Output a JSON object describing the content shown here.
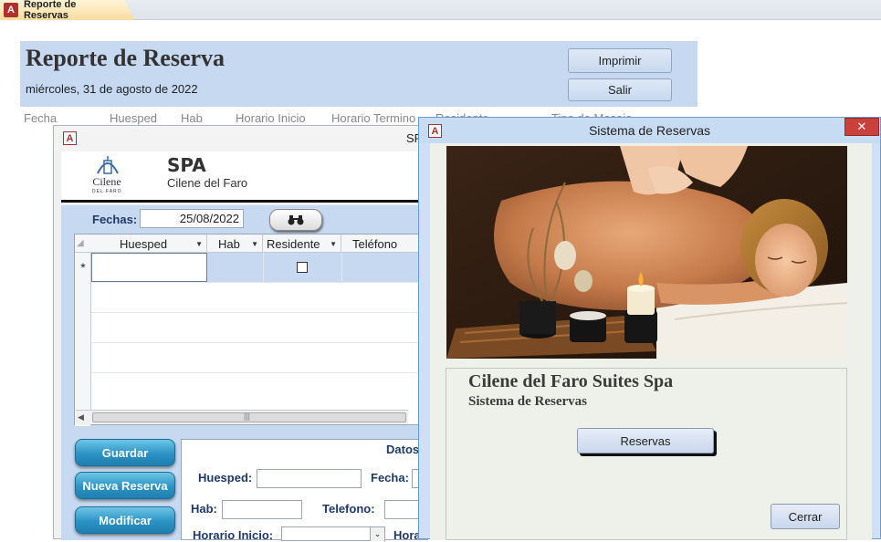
{
  "tab": {
    "label": "Reporte de Reservas",
    "icon": "access-app-icon"
  },
  "report": {
    "title": "Reporte de Reserva",
    "date": "miércoles, 31 de agosto de 2022",
    "print_label": "Imprimir",
    "exit_label": "Salir",
    "columns": [
      "Fecha",
      "Huesped",
      "Hab",
      "Horario Inicio",
      "Horario Termino",
      "Residente",
      "Tipo de Masaje"
    ]
  },
  "spa_form": {
    "window_title": "SPA",
    "title": "SPA",
    "subtitle": "Cilene del Faro",
    "logo_text": "Cilene",
    "logo_small": "DEL FARO",
    "fechas_label": "Fechas:",
    "fechas_value": "25/08/2022",
    "grid_headers": [
      "Huesped",
      "Hab",
      "Residente",
      "Teléfono"
    ],
    "new_row_marker": "*",
    "buttons": {
      "guardar": "Guardar",
      "nueva": "Nueva Reserva",
      "modificar": "Modificar"
    },
    "details_title": "Datos",
    "labels": {
      "huesped": "Huesped:",
      "fecha": "Fecha:",
      "hab": "Hab:",
      "telefono": "Telefono:",
      "horario_inicio": "Horario Inicio:",
      "hora": "Hora"
    }
  },
  "sistema": {
    "window_title": "Sistema de Reservas",
    "name": "Cilene del Faro Suites Spa",
    "subtitle": "Sistema de Reservas",
    "reservas_label": "Reservas",
    "cerrar_label": "Cerrar",
    "close_glyph": "✕"
  },
  "colors": {
    "report_header_bg": "#c6d9f0",
    "pill_button": "#2b93c4",
    "access_red": "#b0302f"
  }
}
